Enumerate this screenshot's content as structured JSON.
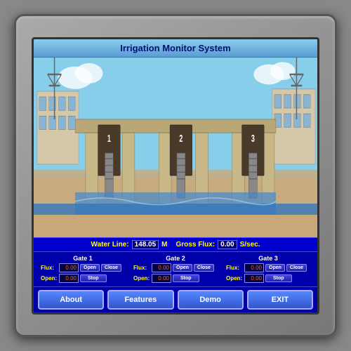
{
  "device": {
    "title": "Irrigation Monitor System"
  },
  "water_info": {
    "water_line_label": "Water Line:",
    "water_line_value": "148.05",
    "water_line_unit": "M",
    "gross_flux_label": "Gross Flux:",
    "gross_flux_value": "0.00",
    "gross_flux_unit": "S/sec."
  },
  "gates": [
    {
      "id": "gate1",
      "title": "Gate 1",
      "flux_label": "Flux:",
      "flux_value": "0.00",
      "open_label": "Open:",
      "open_value": "0.00",
      "btn_open": "Open",
      "btn_close": "Close",
      "btn_stop": "Stop"
    },
    {
      "id": "gate2",
      "title": "Gate 2",
      "flux_label": "Flux:",
      "flux_value": "0.00",
      "open_label": "Open:",
      "open_value": "0.00",
      "btn_open": "Open",
      "btn_close": "Close",
      "btn_stop": "Stop"
    },
    {
      "id": "gate3",
      "title": "Gate 3",
      "flux_label": "Flux:",
      "flux_value": "0.00",
      "open_label": "Open:",
      "open_value": "0.00",
      "btn_open": "Open",
      "btn_close": "Close",
      "btn_stop": "Stop"
    }
  ],
  "buttons": {
    "about": "About",
    "features": "Features",
    "demo": "Demo",
    "exit": "EXIT"
  }
}
